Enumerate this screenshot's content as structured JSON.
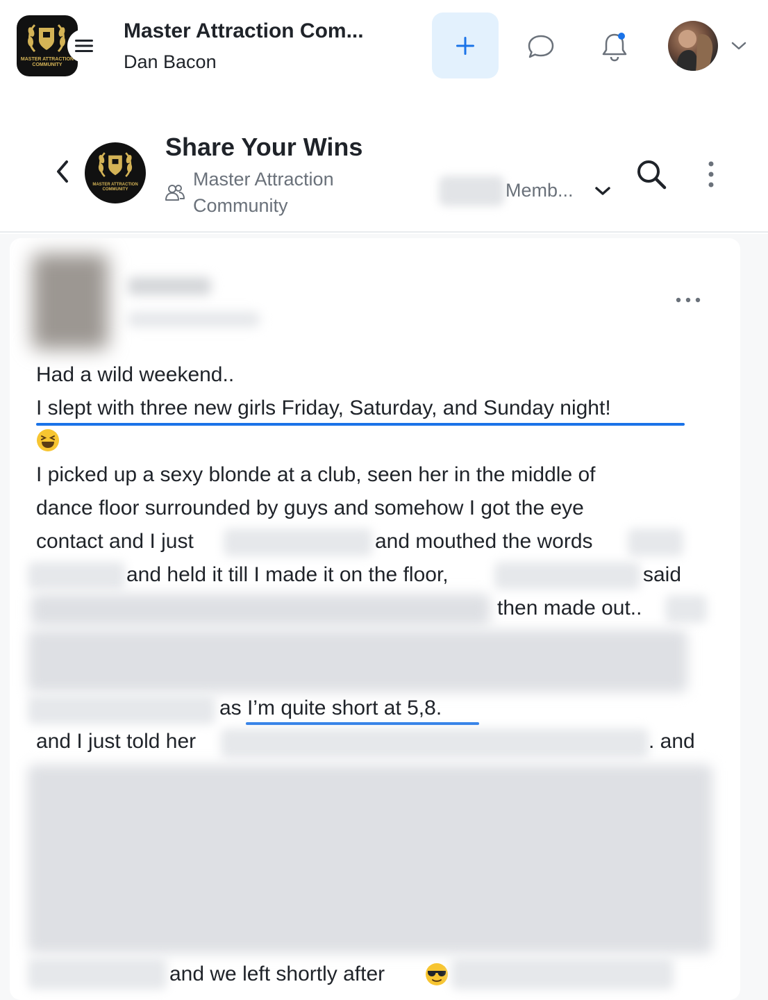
{
  "header": {
    "community_name": "Master Attraction Com...",
    "user_name": "Dan Bacon",
    "logo_text": "MASTER ATTRACTION COMMUNITY"
  },
  "channel": {
    "title": "Share Your Wins",
    "subtitle": "Master Attraction Community",
    "members_label": "Memb..."
  },
  "post": {
    "line1": "Had a wild weekend..",
    "line2": "I slept with three new girls Friday, Saturday, and Sunday night!",
    "line3": "I picked up a sexy blonde at a club, seen her in the middle of",
    "line4": "dance floor surrounded by guys and somehow I got the eye",
    "line5a": "contact and I just",
    "line5b": "and mouthed the words",
    "line6a": "and held it till I made it on the floor,",
    "line6b": "said",
    "line7": "then made out..",
    "line8": "as I’m quite short at 5,8.",
    "line9a": "and I just told her",
    "line9b": ". and",
    "line10": "and we left shortly after"
  },
  "colors": {
    "accent": "#1a73e8",
    "add_button_bg": "#e3f1fd",
    "notification_dot": "#1a73e8",
    "logo_gold": "#d4b356"
  },
  "icons": {
    "menu": "hamburger-icon",
    "add": "plus-icon",
    "chat": "chat-bubble-icon",
    "notifications": "bell-icon",
    "back": "chevron-left-icon",
    "members": "people-icon",
    "search": "search-icon",
    "more": "more-vertical-icon",
    "post_more": "more-horizontal-icon"
  }
}
